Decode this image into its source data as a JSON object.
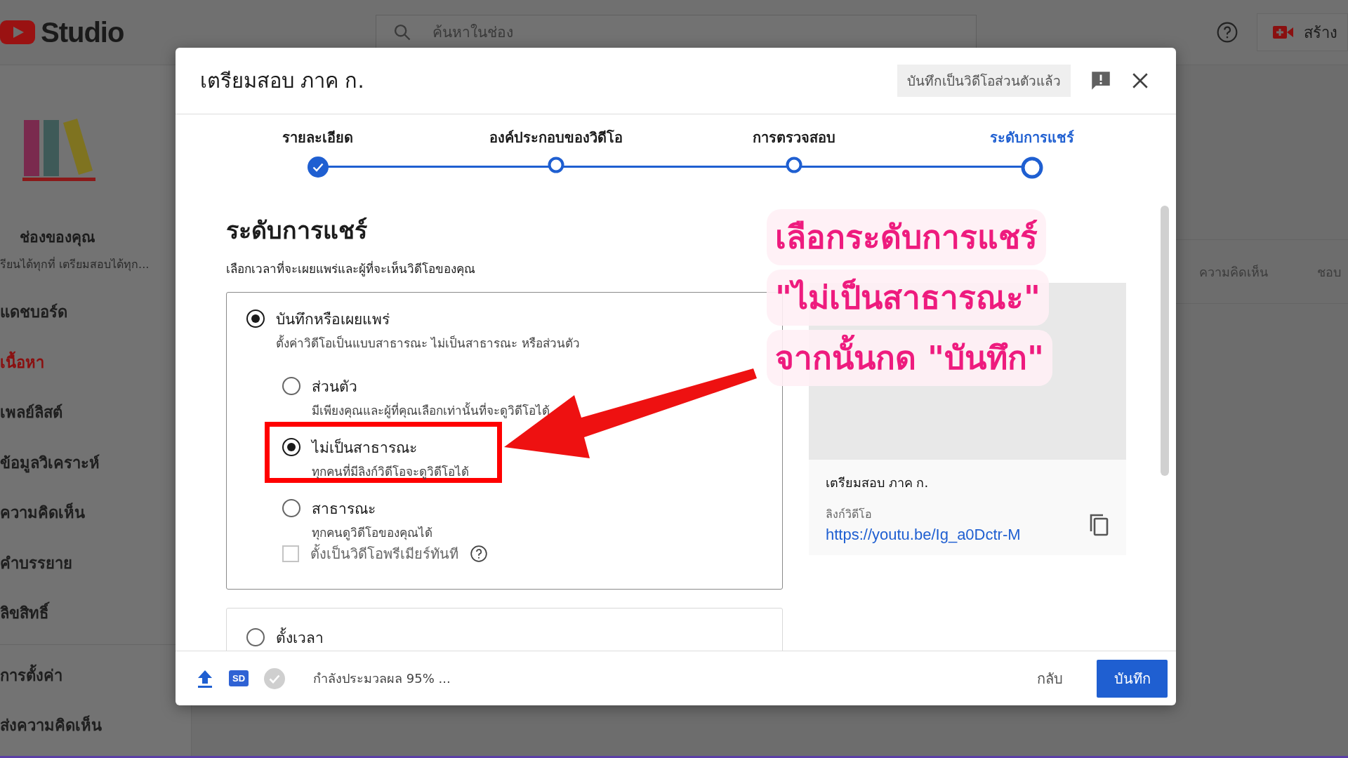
{
  "topbar": {
    "logo": "Studio",
    "search_placeholder": "ค้นหาในช่อง",
    "create_label": "สร้าง"
  },
  "sidebar": {
    "channel_title": "ช่องของคุณ",
    "channel_subtitle": "รียนได้ทุกที่ เตรียมสอบได้ทุก...",
    "items": [
      {
        "label": "แดชบอร์ด",
        "selected": false
      },
      {
        "label": "เนื้อหา",
        "selected": true
      },
      {
        "label": "เพลย์ลิสต์",
        "selected": false
      },
      {
        "label": "ข้อมูลวิเคราะห์",
        "selected": false
      },
      {
        "label": "ความคิดเห็น",
        "selected": false
      },
      {
        "label": "คำบรรยาย",
        "selected": false
      },
      {
        "label": "ลิขสิทธิ์",
        "selected": false
      }
    ],
    "footer_items": [
      {
        "label": "การตั้งค่า"
      },
      {
        "label": "ส่งความคิดเห็น"
      }
    ]
  },
  "background_table": {
    "columns": [
      "ความคิดเห็น",
      "ชอบ"
    ]
  },
  "dialog": {
    "title": "เตรียมสอบ ภาค ก.",
    "saved_badge": "บันทึกเป็นวิดีโอส่วนตัวแล้ว",
    "steps": [
      {
        "label": "รายละเอียด",
        "done": true,
        "selected": false
      },
      {
        "label": "องค์ประกอบของวิดีโอ",
        "done": false,
        "selected": false
      },
      {
        "label": "การตรวจสอบ",
        "done": false,
        "selected": false
      },
      {
        "label": "ระดับการแชร์",
        "done": false,
        "selected": true
      }
    ],
    "heading": "ระดับการแชร์",
    "subheading": "เลือกเวลาที่จะเผยแพร่และผู้ที่จะเห็นวิดีโอของคุณ",
    "save_option": {
      "label": "บันทึกหรือเผยแพร่",
      "description": "ตั้งค่าวิดีโอเป็นแบบสาธารณะ ไม่เป็นสาธารณะ หรือส่วนตัว",
      "selected": true,
      "options": [
        {
          "label": "ส่วนตัว",
          "description": "มีเพียงคุณและผู้ที่คุณเลือกเท่านั้นที่จะดูวิดีโอได้",
          "selected": false,
          "highlighted": false
        },
        {
          "label": "ไม่เป็นสาธารณะ",
          "description": "ทุกคนที่มีลิงก์วิดีโอจะดูวิดีโอได้",
          "selected": true,
          "highlighted": true
        },
        {
          "label": "สาธารณะ",
          "description": "ทุกคนดูวิดีโอของคุณได้",
          "selected": false,
          "highlighted": false
        }
      ],
      "premiere": {
        "label": "ตั้งเป็นวิดีโอพรีเมียร์ทันที",
        "checked": false
      }
    },
    "schedule_option": {
      "label": "ตั้งเวลา",
      "selected": false
    },
    "preview": {
      "title": "เตรียมสอบ ภาค ก.",
      "link_label": "ลิงก์วิดีโอ",
      "link": "https://youtu.be/Ig_a0Dctr-M"
    },
    "footer": {
      "quality_badge": "SD",
      "status": "กำลังประมวลผล 95% ...",
      "back": "กลับ",
      "save": "บันทึก"
    }
  },
  "annotation": {
    "lines": [
      "เลือกระดับการแชร์",
      "\"ไม่เป็นสาธารณะ\"",
      "จากนั้นกด \"บันทึก\""
    ]
  }
}
